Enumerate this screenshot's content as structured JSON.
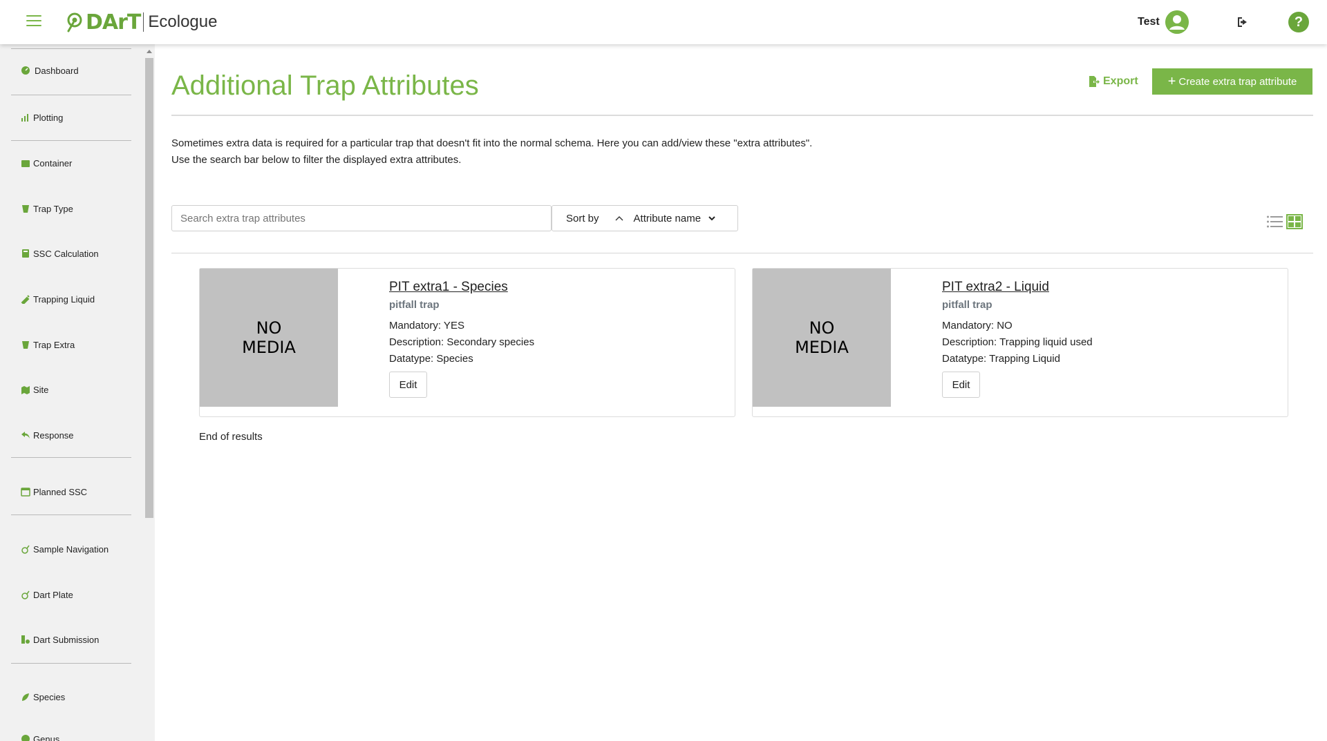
{
  "header": {
    "logo_text": "DArT",
    "logo_subtitle": "Ecologue",
    "user_name": "Test"
  },
  "sidebar": {
    "items": [
      {
        "label": "Dashboard",
        "icon": "dashboard-icon"
      },
      {
        "label": "Plotting",
        "icon": "plotting-icon"
      },
      {
        "label": "Container",
        "icon": "container-icon"
      },
      {
        "label": "Trap Type",
        "icon": "trap-icon"
      },
      {
        "label": "SSC Calculation",
        "icon": "calculator-icon"
      },
      {
        "label": "Trapping Liquid",
        "icon": "dropper-icon"
      },
      {
        "label": "Trap Extra",
        "icon": "trap-icon"
      },
      {
        "label": "Site",
        "icon": "map-icon"
      },
      {
        "label": "Response",
        "icon": "reply-icon"
      },
      {
        "label": "Planned SSC",
        "icon": "calendar-icon"
      },
      {
        "label": "Sample Navigation",
        "icon": "sample-icon"
      },
      {
        "label": "Dart Plate",
        "icon": "sample-icon"
      },
      {
        "label": "Dart Submission",
        "icon": "submission-icon"
      },
      {
        "label": "Species",
        "icon": "species-icon"
      },
      {
        "label": "Genus",
        "icon": "genus-icon"
      }
    ]
  },
  "main": {
    "title": "Additional Trap Attributes",
    "export_label": "Export",
    "create_label": "Create extra trap attribute",
    "description_line1": "Sometimes extra data is required for a particular trap that doesn't fit into the normal schema. Here you can add/view these \"extra attributes\".",
    "description_line2": "Use the search bar below to filter the displayed extra attributes.",
    "search_placeholder": "Search extra trap attributes",
    "sort_label": "Sort by",
    "sort_field": "Attribute name",
    "end_of_results": "End of results",
    "cards": [
      {
        "media_line1": "NO",
        "media_line2": "MEDIA",
        "title": "PIT extra1 - Species",
        "subtitle": "pitfall trap",
        "mandatory": "Mandatory: YES",
        "description": "Description: Secondary species",
        "datatype": "Datatype: Species",
        "edit_label": "Edit"
      },
      {
        "media_line1": "NO",
        "media_line2": "MEDIA",
        "title": "PIT extra2 - Liquid",
        "subtitle": "pitfall trap",
        "mandatory": "Mandatory: NO",
        "description": "Description: Trapping liquid used",
        "datatype": "Datatype: Trapping Liquid",
        "edit_label": "Edit"
      }
    ]
  },
  "colors": {
    "accent": "#7ab648",
    "media_placeholder": "#c1c1c1"
  }
}
